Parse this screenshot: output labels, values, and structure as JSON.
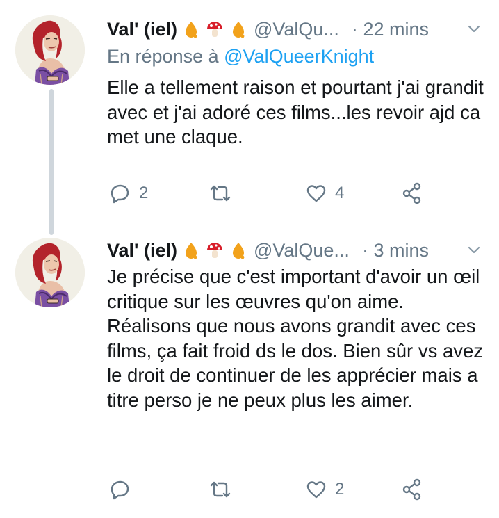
{
  "tweets": [
    {
      "author_name": "Val' (iel)",
      "handle": "@ValQu...",
      "separator": "·",
      "time": "22 mins",
      "reply_prefix": "En réponse à",
      "reply_mention": "@ValQueerKnight",
      "text": "Elle a tellement raison et pourtant j'ai grandit avec et j'ai adoré ces films...les revoir ajd ca met une claque.",
      "reply_count": "2",
      "retweet_count": "",
      "like_count": "4"
    },
    {
      "author_name": "Val' (iel)",
      "handle": "@ValQue...",
      "separator": "·",
      "time": "3 mins",
      "text": "Je précise que c'est important d'avoir un œil critique sur les œuvres qu'on aime. Réalisons que nous avons grandit avec ces films, ça fait froid ds le dos. Bien sûr vs avez le droit de continuer de les apprécier mais a titre perso je ne peux plus les aimer.",
      "reply_count": "",
      "retweet_count": "",
      "like_count": "2"
    }
  ],
  "icons": {
    "name_emojis": [
      "drop-emoji",
      "mushroom-emoji",
      "drop-emoji"
    ],
    "actions": [
      "reply-icon",
      "retweet-icon",
      "like-icon",
      "share-icon"
    ],
    "menu": "chevron-down-icon"
  },
  "colors": {
    "link": "#1da1f2",
    "secondary_text": "#657786",
    "primary_text": "#14171a",
    "thread_line": "#cfd6dc",
    "drop": "#f2a21b",
    "mushroom": "#d81e2a"
  }
}
